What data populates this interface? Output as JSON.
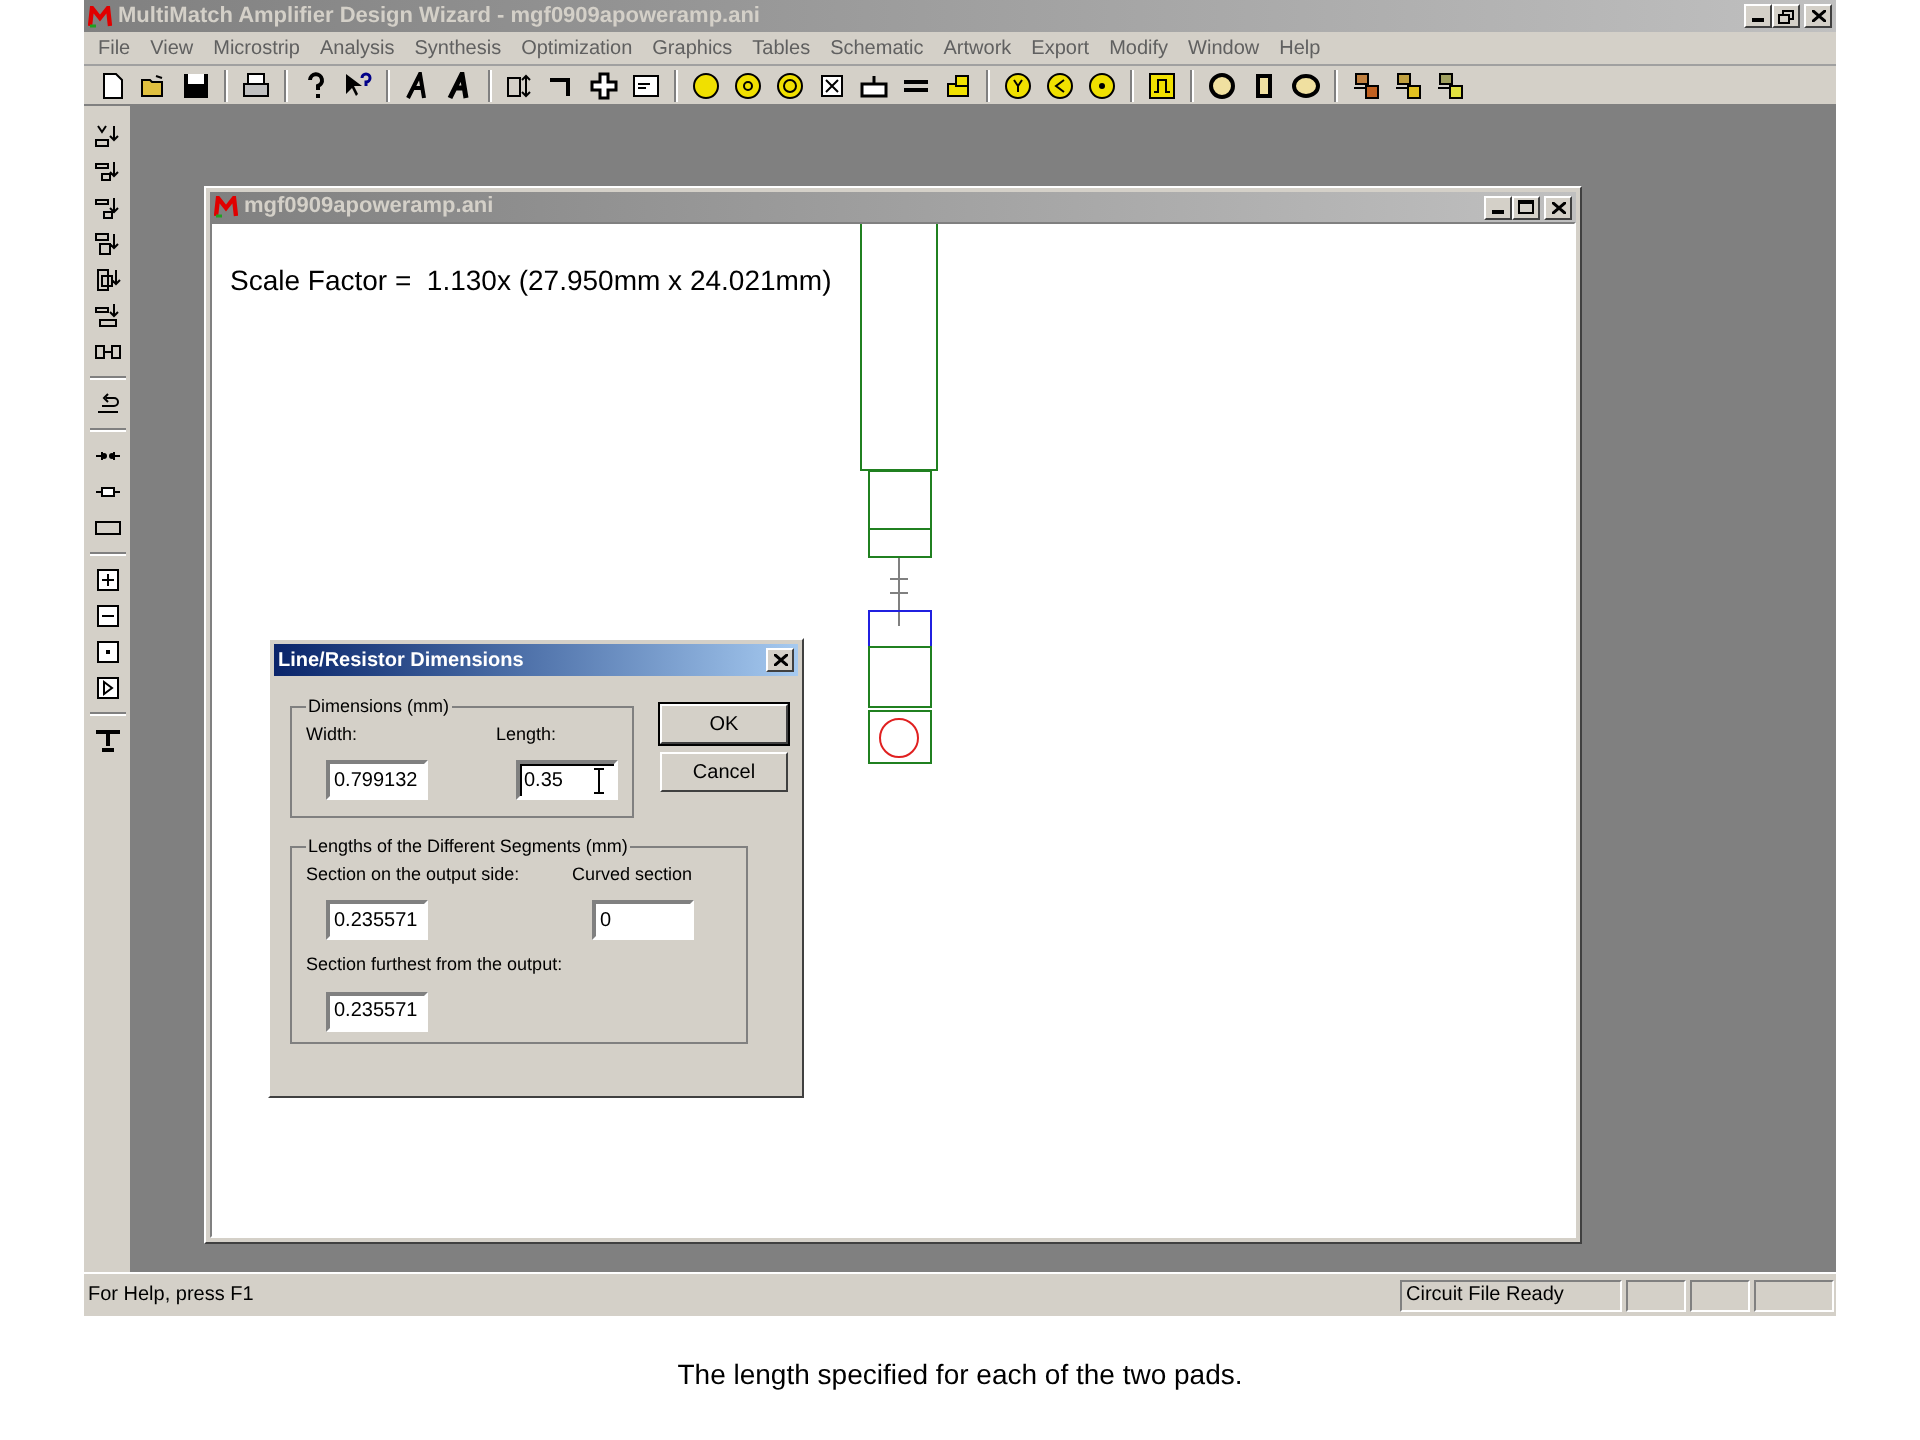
{
  "app": {
    "title": "MultiMatch Amplifier Design Wizard - mgf0909apoweramp.ani"
  },
  "menu": [
    "File",
    "View",
    "Microstrip",
    "Analysis",
    "Synthesis",
    "Optimization",
    "Graphics",
    "Tables",
    "Schematic",
    "Artwork",
    "Export",
    "Modify",
    "Window",
    "Help"
  ],
  "document": {
    "title": "mgf0909apoweramp.ani",
    "scale_text": "Scale Factor =  1.130x (27.950mm x 24.021mm)"
  },
  "dialog": {
    "title": "Line/Resistor Dimensions",
    "dimensions_group": {
      "label": "Dimensions (mm)",
      "fields": [
        {
          "label": "Width:",
          "value": "0.799132",
          "focused": false
        },
        {
          "label": "Length:",
          "value": "0.35",
          "focused": true
        }
      ]
    },
    "segments_group": {
      "label": "Lengths of the Different Segments (mm)",
      "fields": [
        {
          "label": "Section on the output side:",
          "value": "0.235571"
        },
        {
          "label": "Curved section",
          "value": "0"
        },
        {
          "label": "Section furthest from the output:",
          "value": "0.235571"
        }
      ]
    },
    "buttons": [
      {
        "label": "OK",
        "default": true
      },
      {
        "label": "Cancel",
        "default": false
      }
    ]
  },
  "status_bar": [
    "For Help, press F1",
    "Circuit File Ready"
  ],
  "caption": "The length specified for each of the two pads."
}
